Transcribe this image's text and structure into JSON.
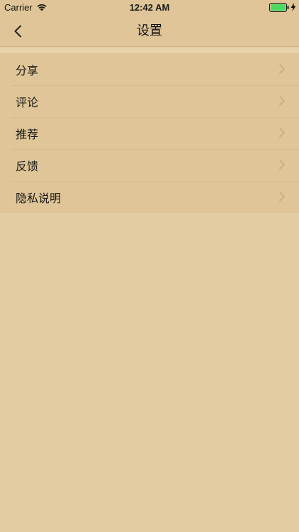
{
  "status_bar": {
    "carrier": "Carrier",
    "time": "12:42 AM",
    "icons": [
      "wifi-icon",
      "battery-icon",
      "bolt-icon"
    ],
    "battery_color": "#4cd964"
  },
  "nav": {
    "title": "设置",
    "back_icon": "chevron-left-icon"
  },
  "menu": {
    "items": [
      {
        "label": "分享"
      },
      {
        "label": "评论"
      },
      {
        "label": "推荐"
      },
      {
        "label": "反馈"
      },
      {
        "label": "隐私说明"
      }
    ],
    "chevron_icon": "chevron-right-icon"
  },
  "colors": {
    "background": "#e3cba2",
    "header": "#dfc597",
    "list": "#dfc597"
  }
}
